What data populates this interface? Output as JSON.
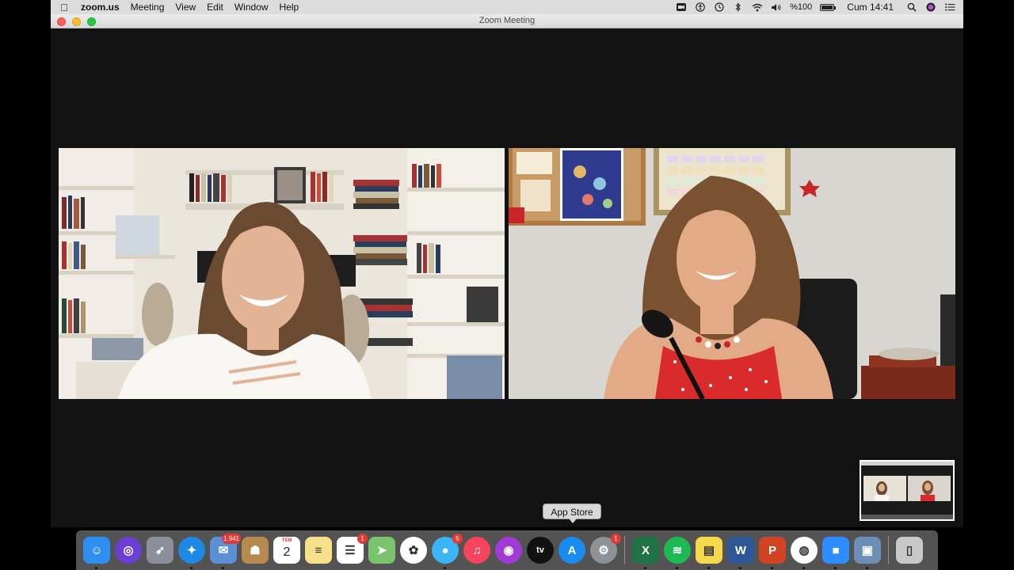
{
  "menubar": {
    "app_name": "zoom.us",
    "menus": [
      "Meeting",
      "View",
      "Edit",
      "Window",
      "Help"
    ],
    "battery": "%100",
    "clock": "Cum 14:41",
    "battery_level": 1.0
  },
  "window": {
    "title": "Zoom Meeting"
  },
  "dock": {
    "tooltip": "App Store",
    "calendar_month": "TEM",
    "calendar_day": "2",
    "items": [
      {
        "name": "Finder",
        "icon": "finder-icon",
        "color": "#2f8ff0",
        "running": true
      },
      {
        "name": "Siri",
        "icon": "siri-icon",
        "color": "#6b3fd6",
        "running": false
      },
      {
        "name": "Launchpad",
        "icon": "rocket-icon",
        "color": "#8a8f99",
        "running": false
      },
      {
        "name": "Safari",
        "icon": "compass-icon",
        "color": "#1e88e5",
        "running": true
      },
      {
        "name": "Mail",
        "icon": "mail-stamp-icon",
        "color": "#5c8fd6",
        "badge": "1.941",
        "running": true
      },
      {
        "name": "Contacts",
        "icon": "contacts-icon",
        "color": "#b58a4c",
        "running": false
      },
      {
        "name": "Calendar",
        "icon": "calendar-icon",
        "color": "#ffffff",
        "running": false
      },
      {
        "name": "Notes",
        "icon": "notes-icon",
        "color": "#f7e08a",
        "running": false
      },
      {
        "name": "Reminders",
        "icon": "reminders-icon",
        "color": "#ffffff",
        "badge": "1",
        "running": false
      },
      {
        "name": "Maps",
        "icon": "maps-icon",
        "color": "#7cc36e",
        "running": false
      },
      {
        "name": "Photos",
        "icon": "photos-icon",
        "color": "#ffffff",
        "running": false
      },
      {
        "name": "Messages",
        "icon": "messages-icon",
        "color": "#3bb5f5",
        "badge": "5",
        "running": true
      },
      {
        "name": "Music",
        "icon": "music-icon",
        "color": "#f6445c",
        "running": false
      },
      {
        "name": "Podcasts",
        "icon": "podcasts-icon",
        "color": "#a23ad6",
        "running": false
      },
      {
        "name": "TV",
        "icon": "tv-icon",
        "color": "#111111",
        "label": "tv",
        "running": false
      },
      {
        "name": "App Store",
        "icon": "appstore-icon",
        "color": "#1a8cf0",
        "running": false
      },
      {
        "name": "System Preferences",
        "icon": "gear-icon",
        "color": "#8e9196",
        "badge": "1",
        "running": false
      },
      {
        "name": "Excel",
        "icon": "excel-icon",
        "color": "#1f7244",
        "label": "X",
        "running": true
      },
      {
        "name": "Spotify",
        "icon": "spotify-icon",
        "color": "#1db954",
        "running": true
      },
      {
        "name": "Stickies",
        "icon": "stickies-icon",
        "color": "#f5d94a",
        "running": true
      },
      {
        "name": "Word",
        "icon": "word-icon",
        "color": "#2b5797",
        "label": "W",
        "running": true
      },
      {
        "name": "PowerPoint",
        "icon": "powerpoint-icon",
        "color": "#d04423",
        "label": "P",
        "running": true
      },
      {
        "name": "Chrome",
        "icon": "chrome-icon",
        "color": "#ffffff",
        "running": true
      },
      {
        "name": "Zoom",
        "icon": "zoom-camera-icon",
        "color": "#2d8cff",
        "running": true
      },
      {
        "name": "Preview",
        "icon": "preview-icon",
        "color": "#6e8fb5",
        "running": true
      },
      {
        "name": "Trash",
        "icon": "trash-icon",
        "color": "#c8c8c8",
        "running": false
      }
    ]
  }
}
